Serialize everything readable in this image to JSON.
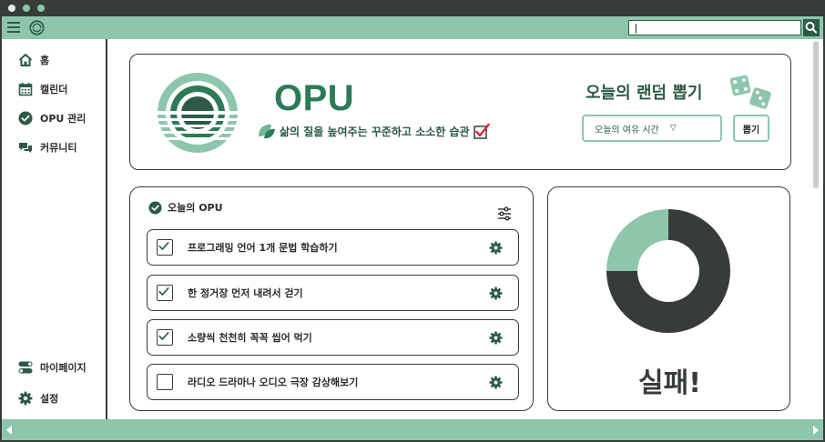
{
  "colors": {
    "dark": "#373c39",
    "mint": "#8ec6ac",
    "brand_green": "#2c7a56",
    "deep_green": "#2c5a45"
  },
  "toolbar": {
    "search_value": "|"
  },
  "sidebar": {
    "items": [
      {
        "label": "홈",
        "icon": "home-icon"
      },
      {
        "label": "캘린더",
        "icon": "calendar-icon"
      },
      {
        "label": "OPU 관리",
        "icon": "check-circle-icon"
      },
      {
        "label": "커뮤니티",
        "icon": "chat-icon"
      }
    ],
    "bottom_items": [
      {
        "label": "마이페이지",
        "icon": "toggle-icon"
      },
      {
        "label": "설정",
        "icon": "gear-icon"
      }
    ]
  },
  "hero": {
    "brand": "OPU",
    "tagline": "삶의 질을 높여주는 꾸준하고 소소한 습관",
    "random_title": "오늘의 랜덤 뽑기",
    "dropdown_value": "오늘의 여유 시간",
    "draw_button": "뽑기"
  },
  "opu": {
    "title": "오늘의 OPU",
    "tasks": [
      {
        "label": "프로그래밍 언어 1개 문법 학습하기",
        "checked": true
      },
      {
        "label": "한 정거장 먼저 내려서 걷기",
        "checked": true
      },
      {
        "label": "소량씩 천천히 꼭꼭 씹어 먹기",
        "checked": true
      },
      {
        "label": "라디오 드라마나 오디오 극장 감상해보기",
        "checked": false
      }
    ]
  },
  "result": {
    "completed_fraction": 0.75,
    "label": "실패!"
  }
}
